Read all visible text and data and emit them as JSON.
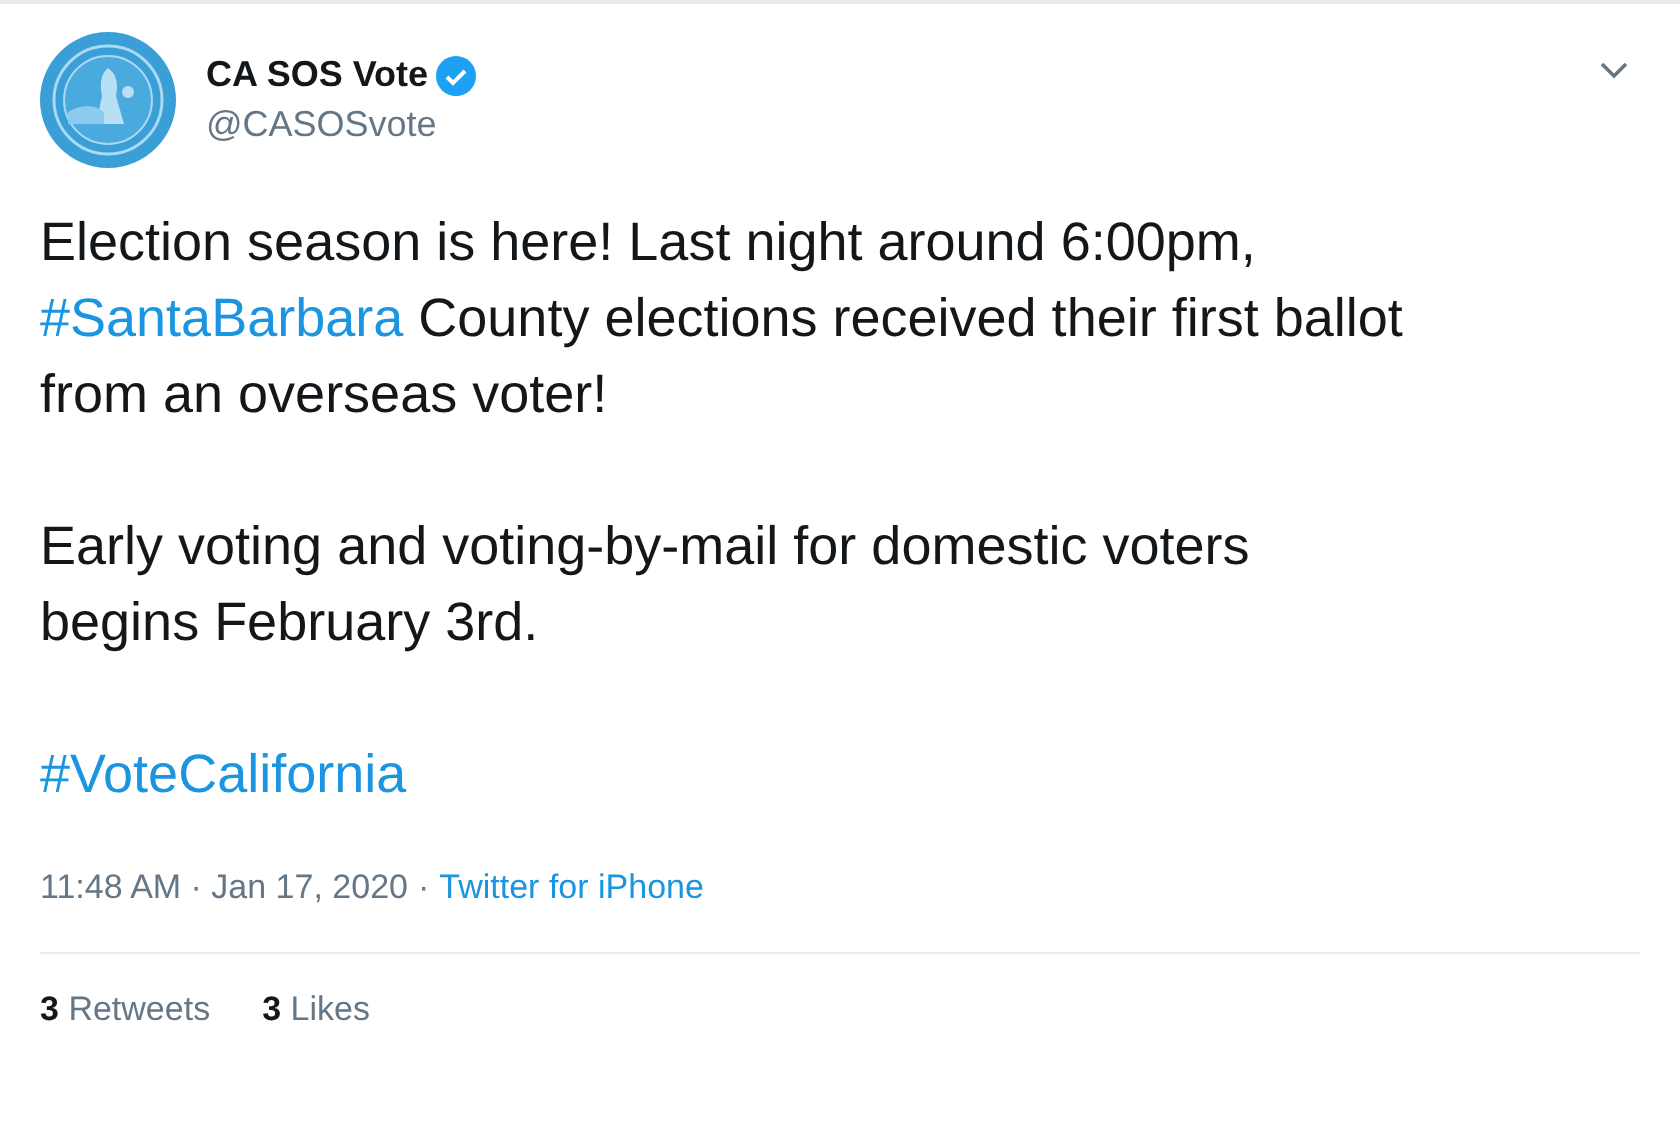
{
  "author": {
    "name": "CA SOS Vote",
    "verified": true,
    "handle": "@CASOSvote"
  },
  "paragraphs": [
    [
      {
        "kind": "text",
        "text": "Election season is here! Last night around 6:00pm, "
      },
      {
        "kind": "hashtag",
        "text": "#SantaBarbara"
      },
      {
        "kind": "text",
        "text": " County elections received their first ballot from an overseas voter!"
      }
    ],
    [
      {
        "kind": "text",
        "text": "Early voting and voting-by-mail for domestic voters begins February 3rd."
      }
    ],
    [
      {
        "kind": "hashtag",
        "text": "#VoteCalifornia"
      }
    ]
  ],
  "timestamp": "11:48 AM · Jan 17, 2020",
  "separator": "·",
  "source": "Twitter for iPhone",
  "stats": [
    {
      "count": "3",
      "label": "Retweets"
    },
    {
      "count": "3",
      "label": "Likes"
    }
  ]
}
